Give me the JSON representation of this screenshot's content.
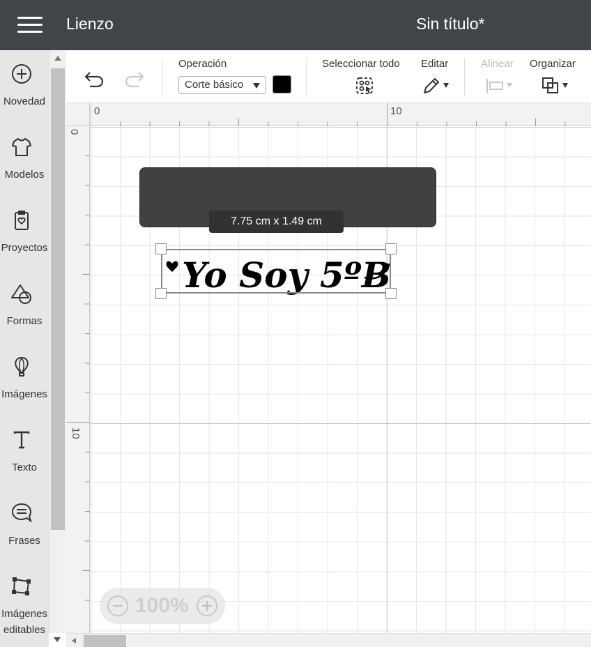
{
  "header": {
    "app_title": "Lienzo",
    "doc_title": "Sin título*"
  },
  "sidebar": {
    "items": [
      {
        "label": "Novedad",
        "icon": "plus-circle-icon"
      },
      {
        "label": "Modelos",
        "icon": "tshirt-icon"
      },
      {
        "label": "Proyectos",
        "icon": "project-icon"
      },
      {
        "label": "Formas",
        "icon": "shapes-icon"
      },
      {
        "label": "Imágenes",
        "icon": "balloon-icon"
      },
      {
        "label": "Texto",
        "icon": "text-icon"
      },
      {
        "label": "Frases",
        "icon": "chat-bubble-icon"
      },
      {
        "label": "Imágenes editables",
        "icon": "edit-image-icon"
      }
    ]
  },
  "toolbar": {
    "operation_label": "Operación",
    "operation_value": "Corte básico",
    "operation_color": "#000000",
    "select_all_label": "Seleccionar todo",
    "edit_label": "Editar",
    "align_label": "Alinear",
    "organize_label": "Organizar"
  },
  "ruler": {
    "top_marks": [
      "0",
      "10"
    ],
    "left_marks": [
      "0",
      "10"
    ]
  },
  "canvas": {
    "dimension_label": "7.75  cm x 1.49  cm",
    "design_text": "Yo Soy 5ºB",
    "shape_color": "#414141"
  },
  "zoom": {
    "level": "100%"
  }
}
